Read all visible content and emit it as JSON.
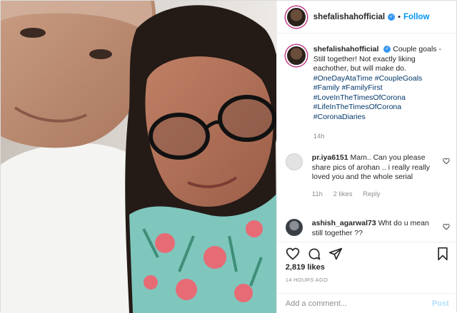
{
  "post": {
    "author": "shefalishahofficial",
    "follow_label": "Follow",
    "separator": "•"
  },
  "caption": {
    "author": "shefalishahofficial",
    "text": "Couple goals - Still together! Not exactly liking eachother, but will make do.",
    "hashtags": [
      "#OneDayAtaTime #CoupleGoals",
      "#Family #FamilyFirst",
      "#LoveInTheTimesOfCorona",
      "#LifeInTheTimesOfCorona",
      "#CoronaDiaries"
    ],
    "time": "14h"
  },
  "comments": [
    {
      "author": "pr.iya6151",
      "text": "Mam.. Can you please share pics of arohan .. i really really loved you and the whole serial",
      "time": "11h",
      "likes": "2 likes",
      "reply": "Reply"
    },
    {
      "author": "ashish_agarwal73",
      "text": "Wht do u mean still together ??"
    }
  ],
  "stats": {
    "likes": "2,819 likes",
    "posted": "14 HOURS AGO"
  },
  "add_comment": {
    "placeholder": "Add a comment...",
    "post_label": "Post"
  },
  "icons": [
    "verified-badge-icon",
    "heart-icon",
    "comment-icon",
    "share-icon",
    "bookmark-icon",
    "small-heart-icon"
  ],
  "colors": {
    "accent_blue": "#0095f6",
    "verified": "#3897f0",
    "hashtag": "#00376b",
    "muted": "#8e8e8e",
    "post_disabled": "#b2dffc"
  }
}
